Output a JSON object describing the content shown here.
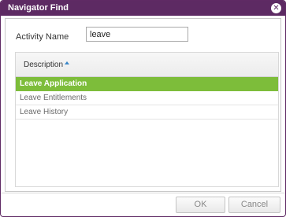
{
  "dialog": {
    "title": "Navigator Find",
    "close_glyph": "✕",
    "close_icon": "close-icon"
  },
  "form": {
    "activity_label": "Activity Name",
    "search_value": "leave"
  },
  "grid": {
    "column_header": "Description",
    "sort_direction": "ascending",
    "rows": [
      {
        "label": "Leave Application",
        "selected": true
      },
      {
        "label": "Leave Entitlements",
        "selected": false
      },
      {
        "label": "Leave History",
        "selected": false
      }
    ],
    "selected_color": "#7dbd3a"
  },
  "buttons": {
    "ok_label": "OK",
    "cancel_label": "Cancel"
  },
  "colors": {
    "titlebar": "#5d2a63"
  }
}
